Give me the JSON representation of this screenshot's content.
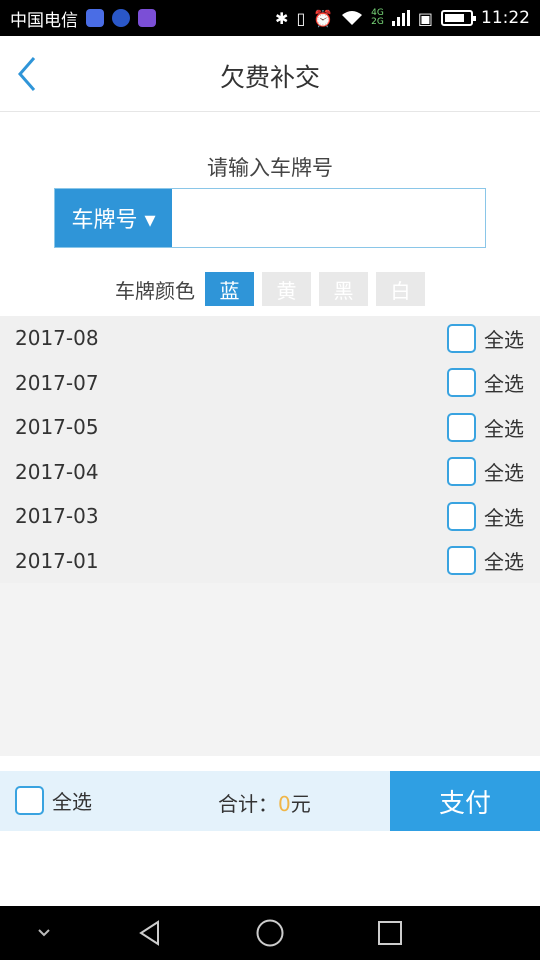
{
  "status_bar": {
    "carrier": "中国电信",
    "app_icons": [
      "shield-app-icon",
      "browser-app-icon",
      "gallery-app-icon"
    ],
    "network_4g": "4G",
    "network_2g": "2G",
    "time": "11:22",
    "battery_level": 0.8
  },
  "header": {
    "title": "欠费补交",
    "back_icon": "chevron-left-icon"
  },
  "plate": {
    "prompt": "请输入车牌号",
    "type_button": "车牌号 ▾",
    "input_value": "",
    "input_placeholder": ""
  },
  "plate_color": {
    "label": "车牌颜色",
    "options": [
      "蓝",
      "黄",
      "黑",
      "白"
    ],
    "selected": "蓝",
    "colors": {
      "active": "#2f95d8",
      "inactive": "#e9e9e9"
    }
  },
  "months": [
    {
      "month": "2017-08",
      "select_label": "全选"
    },
    {
      "month": "2017-07",
      "select_label": "全选"
    },
    {
      "month": "2017-05",
      "select_label": "全选"
    },
    {
      "month": "2017-04",
      "select_label": "全选"
    },
    {
      "month": "2017-03",
      "select_label": "全选"
    },
    {
      "month": "2017-01",
      "select_label": "全选"
    }
  ],
  "footer": {
    "select_all": "全选",
    "total_label": "合计：",
    "total_amount": "0",
    "total_unit": "元",
    "pay_button": "支付"
  },
  "nav_bar": {
    "icons": [
      "collapse-icon",
      "back-triangle-icon",
      "home-circle-icon",
      "recents-square-icon"
    ]
  },
  "colors": {
    "accent": "#2f95d8",
    "amount": "#f0b648",
    "checkbox_border": "#39a3e0"
  }
}
